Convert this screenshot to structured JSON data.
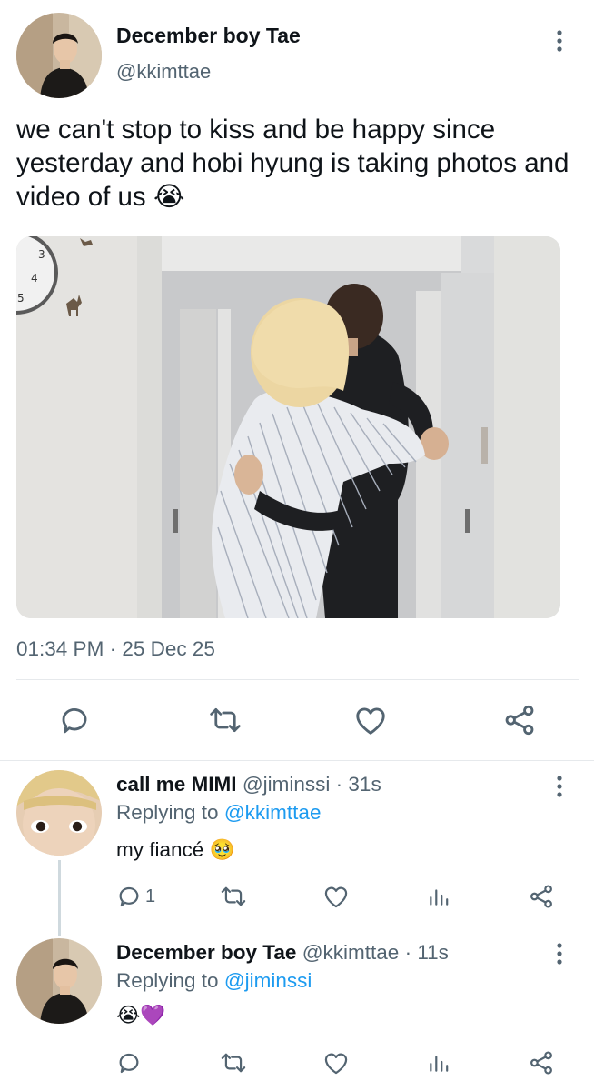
{
  "main_tweet": {
    "display_name": "December boy Tae",
    "handle": "@kkimttae",
    "text": "we can't stop to kiss and be happy since yesterday and hobi hyung is taking photos and video of us",
    "emoji": "😭",
    "time": "01:34 PM",
    "separator": "·",
    "date": "25 Dec 25",
    "clock_numbers": [
      "3",
      "4",
      "5"
    ]
  },
  "replies": [
    {
      "display_name": "call me MIMI",
      "handle": "@jiminssi",
      "time": "· 31s",
      "replying_label": "Replying to",
      "replying_to": "@kkimttae",
      "text": "my fiancé",
      "emoji": "🥹",
      "reply_count": "1"
    },
    {
      "display_name": "December boy Tae",
      "handle": "@kkimttae",
      "time": "· 11s",
      "replying_label": "Replying to",
      "replying_to": "@jiminssi",
      "emoji": "😭💜"
    }
  ],
  "colors": {
    "text": "#0f1419",
    "muted": "#536471",
    "link": "#1d9bf0",
    "divider": "#e6e9ec"
  },
  "icons": {
    "reply": "reply-icon",
    "retweet": "retweet-icon",
    "like": "heart-icon",
    "share": "share-icon",
    "analytics": "analytics-icon",
    "more": "more-icon"
  }
}
